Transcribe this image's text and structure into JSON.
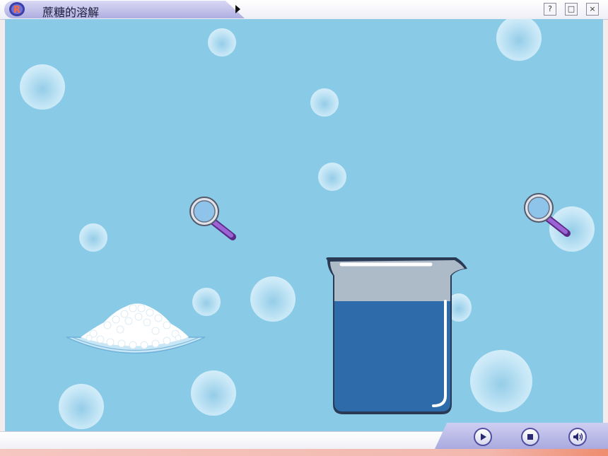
{
  "window": {
    "title": "蔗糖的溶解",
    "help_glyph": "?",
    "restore_glyph": "□",
    "close_glyph": "×"
  },
  "scene": {
    "background_color": "#89cbe7",
    "objects": [
      "sugar-dish",
      "beaker-of-water",
      "magnifier-icon",
      "magnifier-icon"
    ]
  },
  "controls": {
    "items": [
      "play-icon",
      "stop-icon",
      "volume-icon"
    ]
  }
}
